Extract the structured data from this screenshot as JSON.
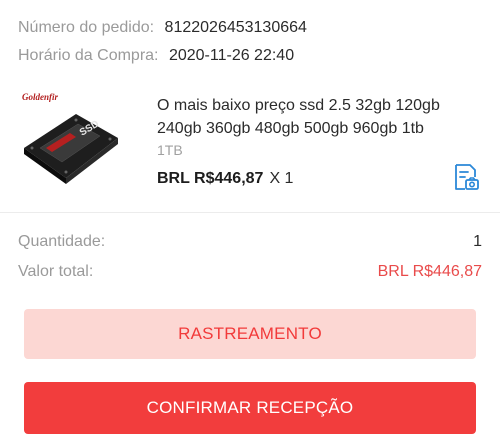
{
  "order": {
    "number_label": "Número do pedido:",
    "number_value": "8122026453130664",
    "time_label": "Horário da Compra:",
    "time_value": "2020-11-26 22:40"
  },
  "product": {
    "brand": "Goldenfir",
    "badge": "SSD",
    "title": "O mais baixo preço ssd 2.5 32gb 120gb 240gb 360gb 480gb 500gb 960gb 1tb",
    "variant": "1TB",
    "price": "BRL R$446,87",
    "qty": "X 1",
    "snapshot_icon": "snapshot-icon"
  },
  "summary": {
    "qty_label": "Quantidade:",
    "qty_value": "1",
    "total_label": "Valor total:",
    "total_value": "BRL R$446,87"
  },
  "buttons": {
    "track": "RASTREAMENTO",
    "confirm": "CONFIRMAR RECEPÇÃO"
  },
  "colors": {
    "accent": "#f23d3d",
    "accent_light": "#fcd7d3",
    "total_red": "#e94b4b",
    "link_blue": "#2b88d8"
  }
}
